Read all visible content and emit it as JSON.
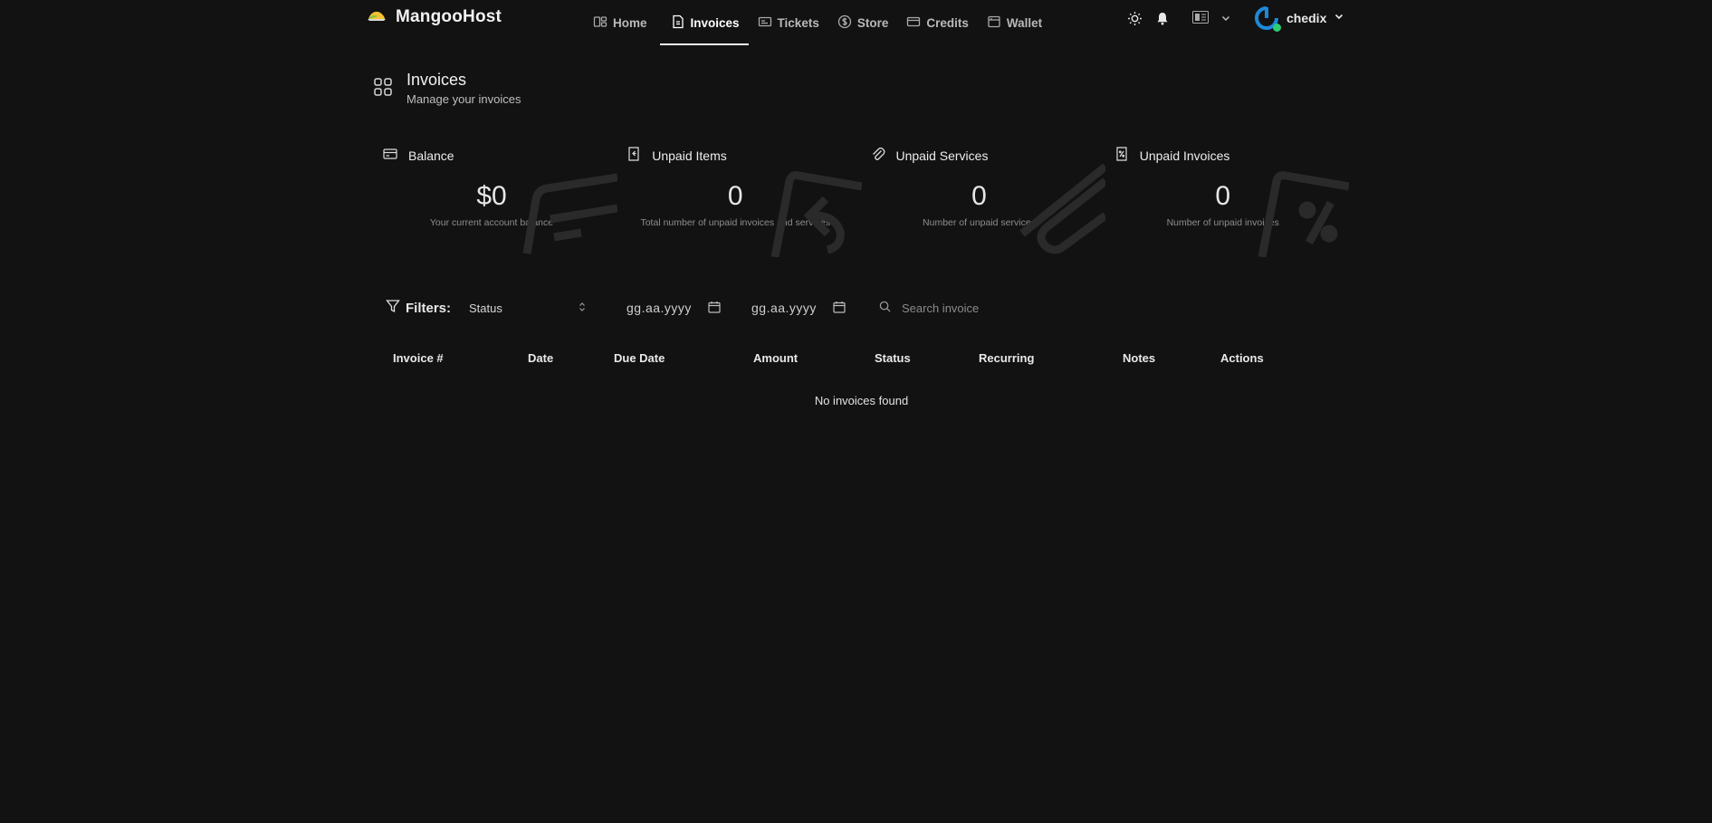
{
  "brand": {
    "name": "MangooHost"
  },
  "nav": [
    {
      "label": "Home",
      "icon": "home-icon"
    },
    {
      "label": "Invoices",
      "icon": "invoice-icon",
      "active": true
    },
    {
      "label": "Tickets",
      "icon": "ticket-icon"
    },
    {
      "label": "Store",
      "icon": "dollar-circle-icon"
    },
    {
      "label": "Credits",
      "icon": "credit-card-icon"
    },
    {
      "label": "Wallet",
      "icon": "wallet-icon"
    }
  ],
  "user": {
    "name": "chedix",
    "status_color": "#2ecc71",
    "avatar_color": "#1e88d8"
  },
  "page": {
    "title": "Invoices",
    "subtitle": "Manage your invoices"
  },
  "cards": [
    {
      "title": "Balance",
      "value": "$0",
      "desc": "Your current account balance",
      "icon": "credit-card-icon"
    },
    {
      "title": "Unpaid Items",
      "value": "0",
      "desc": "Total number of unpaid invoices and services",
      "icon": "receipt-refund-icon"
    },
    {
      "title": "Unpaid Services",
      "value": "0",
      "desc": "Number of unpaid services",
      "icon": "paperclip-icon"
    },
    {
      "title": "Unpaid Invoices",
      "value": "0",
      "desc": "Number of unpaid invoices",
      "icon": "receipt-percent-icon"
    }
  ],
  "filters": {
    "label": "Filters:",
    "status_value": "Status",
    "date_from_placeholder": "gg.aa.yyyy",
    "date_to_placeholder": "gg.aa.yyyy",
    "search_placeholder": "Search invoice"
  },
  "table": {
    "columns": [
      "Invoice #",
      "Date",
      "Due Date",
      "Amount",
      "Status",
      "Recurring",
      "Notes",
      "Actions"
    ],
    "empty_message": "No invoices found"
  },
  "colors": {
    "background": "#121212",
    "text": "#e6e6e6",
    "muted": "#8e8e8e"
  }
}
